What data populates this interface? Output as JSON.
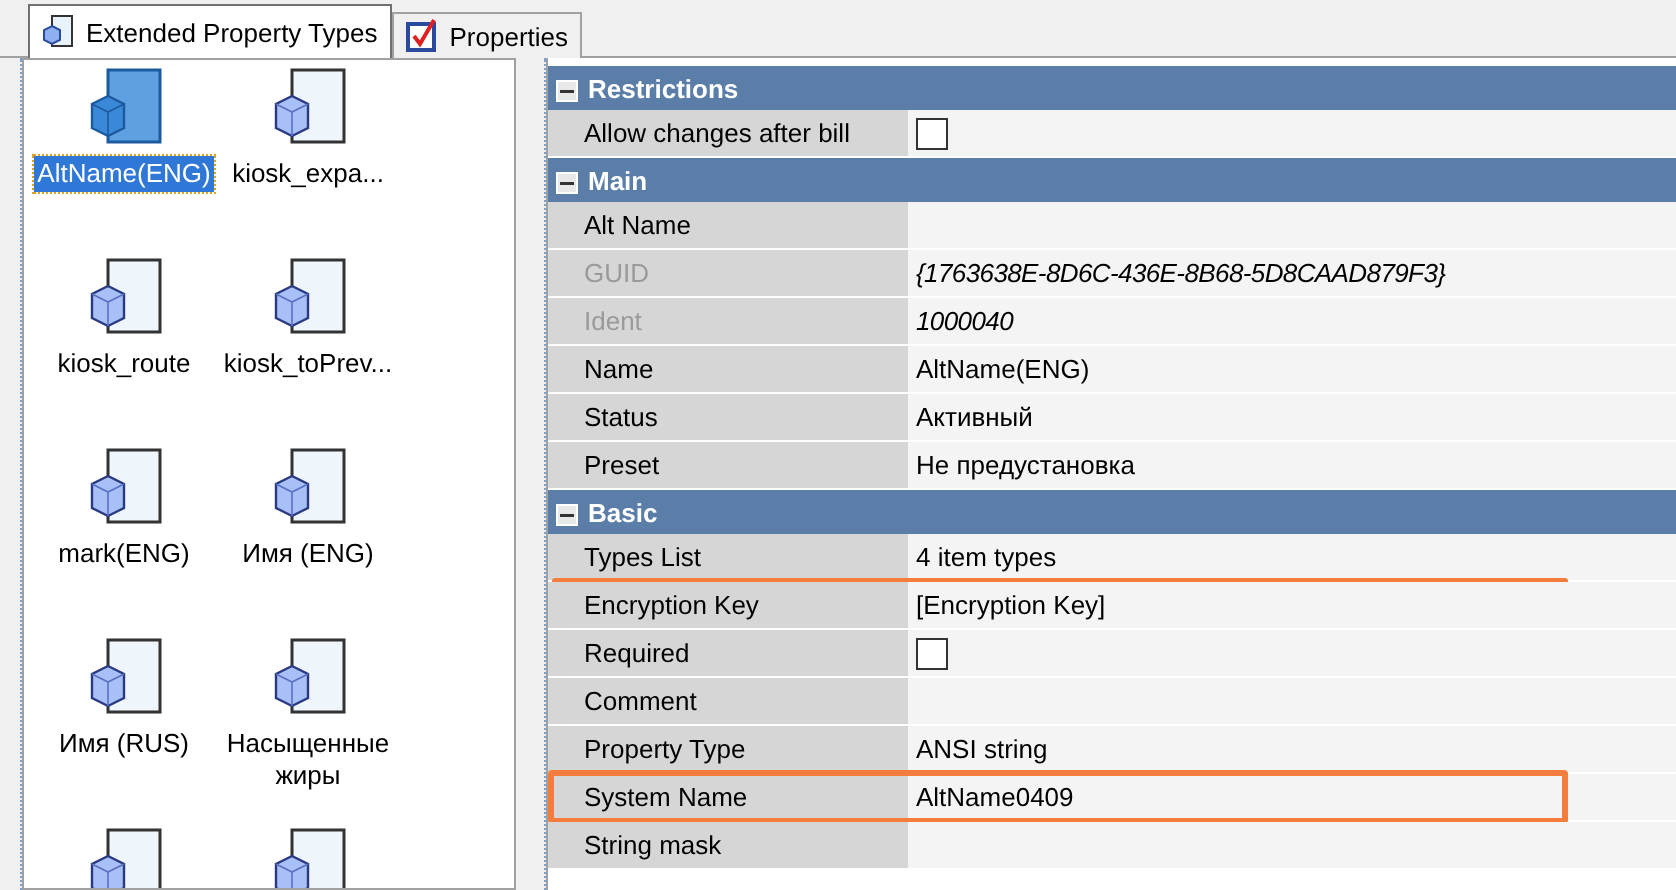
{
  "tabs": [
    {
      "label": "Extended Property Types",
      "kind": "cube",
      "selected": true
    },
    {
      "label": "Properties",
      "kind": "checkbox",
      "selected": false
    }
  ],
  "item_list": {
    "items": [
      {
        "label": "AltName(ENG)",
        "selected": true
      },
      {
        "label": "kiosk_expa...",
        "selected": false
      },
      {
        "label": "kiosk_route",
        "selected": false
      },
      {
        "label": "kiosk_toPrev...",
        "selected": false
      },
      {
        "label": "mark(ENG)",
        "selected": false
      },
      {
        "label": "Имя (ENG)",
        "selected": false
      },
      {
        "label": "Имя (RUS)",
        "selected": false
      },
      {
        "label": "Насыщенные жиры",
        "selected": false
      },
      {
        "selected": false
      },
      {
        "selected": false
      }
    ]
  },
  "property_grid": {
    "sections": [
      {
        "title": "Restrictions",
        "expanded": true,
        "rows": [
          {
            "label": "Allow changes after bill",
            "kind": "checkbox",
            "checked": false,
            "disabled": false,
            "underlined": false,
            "boxed": false
          }
        ]
      },
      {
        "title": "Main",
        "expanded": true,
        "rows": [
          {
            "label": "Alt Name",
            "kind": "text",
            "disabled": false,
            "underlined": false,
            "boxed": false
          },
          {
            "label": "GUID",
            "kind": "text",
            "value": "{1763638E-8D6C-436E-8B68-5D8CAAD879F3}",
            "disabled": true,
            "underlined": false,
            "boxed": false
          },
          {
            "label": "Ident",
            "kind": "text",
            "value": "1000040",
            "disabled": true,
            "underlined": false,
            "boxed": false
          },
          {
            "label": "Name",
            "kind": "text",
            "value": "AltName(ENG)",
            "disabled": false,
            "underlined": false,
            "boxed": false
          },
          {
            "label": "Status",
            "kind": "text",
            "value": "Активный",
            "disabled": false,
            "underlined": false,
            "boxed": false
          },
          {
            "label": "Preset",
            "kind": "text",
            "value": "Не предустановка",
            "disabled": false,
            "underlined": false,
            "boxed": false
          }
        ]
      },
      {
        "title": "Basic",
        "expanded": true,
        "rows": [
          {
            "label": "Types List",
            "kind": "text",
            "value": "4 item types",
            "disabled": false,
            "underlined": true,
            "boxed": false
          },
          {
            "label": "Encryption Key",
            "kind": "text",
            "value": "[Encryption Key]",
            "disabled": false,
            "underlined": false,
            "boxed": false
          },
          {
            "label": "Required",
            "kind": "checkbox",
            "checked": false,
            "disabled": false,
            "underlined": false,
            "boxed": false
          },
          {
            "label": "Comment",
            "kind": "text",
            "disabled": false,
            "underlined": false,
            "boxed": false
          },
          {
            "label": "Property Type",
            "kind": "text",
            "value": "ANSI string",
            "disabled": false,
            "underlined": false,
            "boxed": false
          },
          {
            "label": "System Name",
            "kind": "text",
            "value": "AltName0409",
            "disabled": false,
            "underlined": false,
            "boxed": true
          },
          {
            "label": "String mask",
            "kind": "text",
            "disabled": false,
            "underlined": false,
            "boxed": false
          }
        ]
      }
    ]
  }
}
